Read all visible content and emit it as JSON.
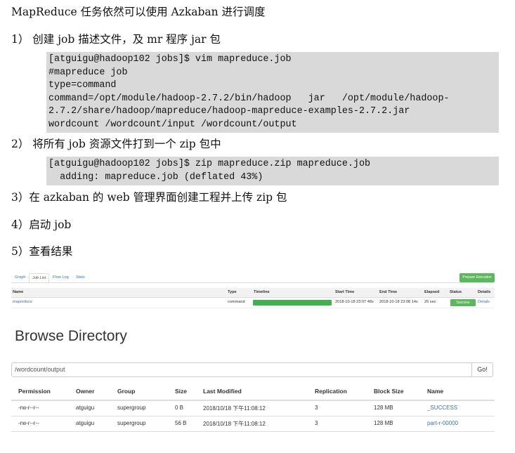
{
  "intro": "MapReduce 任务依然可以使用 Azkaban 进行调度",
  "steps": [
    "1） 创建 job 描述文件，及 mr 程序 jar 包",
    "2） 将所有 job 资源文件打到一个 zip 包中",
    "3）在 azkaban 的 web 管理界面创建工程并上传 zip 包",
    "4）启动 job",
    "5）查看结果"
  ],
  "code1": [
    "[atguigu@hadoop102 jobs]$ vim mapreduce.job",
    "#mapreduce job",
    "type=command",
    "command=/opt/module/hadoop-2.7.2/bin/hadoop   jar   /opt/module/hadoop-",
    "2.7.2/share/hadoop/mapreduce/hadoop-mapreduce-examples-2.7.2.jar",
    "wordcount /wordcount/input /wordcount/output"
  ],
  "code2": [
    "[atguigu@hadoop102 jobs]$ zip mapreduce.zip mapreduce.job",
    "  adding: mapreduce.job (deflated 43%)"
  ],
  "azkaban": {
    "tabs": [
      "Graph",
      "Job List",
      "Flow Log",
      "Stats"
    ],
    "prepare_button": "Prepare Execution",
    "columns": [
      "Name",
      "Type",
      "Timeline",
      "Start Time",
      "End Time",
      "Elapsed",
      "Status",
      "Details"
    ],
    "row": {
      "name": "mapreduce",
      "type": "command",
      "timeline_progress": 1.0,
      "start": "2018-10-18 23:07 48s",
      "end": "2018-10-18 23:08 14s",
      "elapsed": "26 sec",
      "status": "Success",
      "details": "Details"
    },
    "colors": {
      "success": "#5cb85c",
      "link": "#3a74b3"
    }
  },
  "browse": {
    "title": "Browse Directory",
    "path": "/wordcount/output",
    "go": "Go!",
    "columns": [
      "Permission",
      "Owner",
      "Group",
      "Size",
      "Last Modified",
      "Replication",
      "Block Size",
      "Name"
    ],
    "rows": [
      [
        "-rw-r--r--",
        "atguigu",
        "supergroup",
        "0 B",
        "2018/10/18 下午11:08:12",
        "3",
        "128 MB",
        "_SUCCESS"
      ],
      [
        "-rw-r--r--",
        "atguigu",
        "supergroup",
        "56 B",
        "2018/10/18 下午11:08:12",
        "3",
        "128 MB",
        "part-r-00000"
      ]
    ]
  }
}
